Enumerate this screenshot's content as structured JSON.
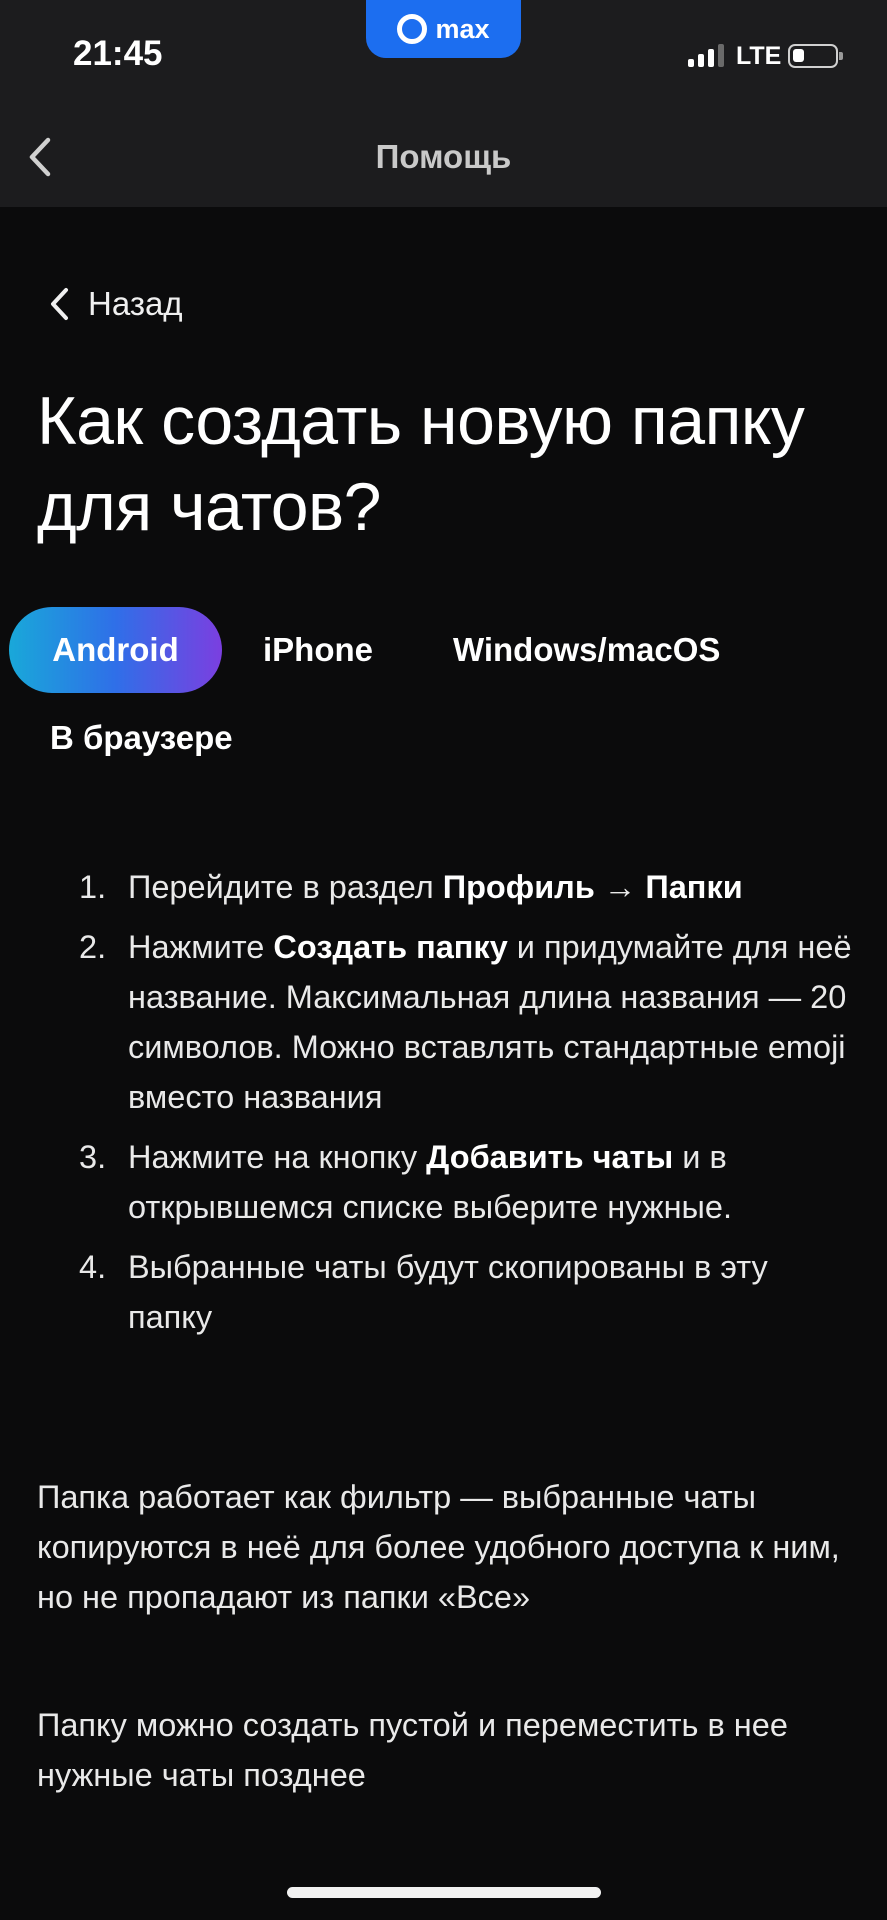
{
  "status_bar": {
    "time": "21:45",
    "app_badge": "max",
    "network": "LTE",
    "signal_bars_active": 3,
    "signal_bars_total": 4,
    "battery_level": 0.2
  },
  "nav": {
    "title": "Помощь",
    "back_icon": "chevron-left-icon"
  },
  "back_link": {
    "label": "Назад"
  },
  "title": "Как создать новую папку для чатов?",
  "tabs": [
    {
      "label": "Android",
      "active": true
    },
    {
      "label": "iPhone",
      "active": false
    },
    {
      "label": "Windows/macOS",
      "active": false
    },
    {
      "label": "В браузере",
      "active": false
    }
  ],
  "steps": [
    {
      "num": "1.",
      "text1": "Перейдите в раздел ",
      "bold1": "Профиль",
      "text2": " → ",
      "bold2": "Папки",
      "text3": ""
    },
    {
      "num": "2.",
      "text1": "Нажмите ",
      "bold1": "Создать папку",
      "text2": " и придумайте для неё название. Максимальная длина названия — 20 символов. Можно вставлять стандартные emoji вместо названия",
      "bold2": "",
      "text3": ""
    },
    {
      "num": "3.",
      "text1": "Нажмите на кнопку ",
      "bold1": "Добавить чаты",
      "text2": " и в открывшемся списке выберите нужные.",
      "bold2": "",
      "text3": ""
    },
    {
      "num": "4.",
      "text1": "Выбранные чаты будут скопированы в эту папку",
      "bold1": "",
      "text2": "",
      "bold2": "",
      "text3": ""
    }
  ],
  "paragraphs": [
    "Папка работает как фильтр — выбранные чаты копируются в неё для более удобного доступа к ним, но не пропадают из папки «Все»",
    "Папку можно создать пустой и переместить в нее нужные чаты позднее"
  ],
  "colors": {
    "background": "#0b0b0c",
    "bar": "#1c1c1e",
    "badge": "#1c6ef0",
    "tab_gradient": [
      "#19a8d9",
      "#2f6fe8",
      "#7b3fe0"
    ]
  }
}
